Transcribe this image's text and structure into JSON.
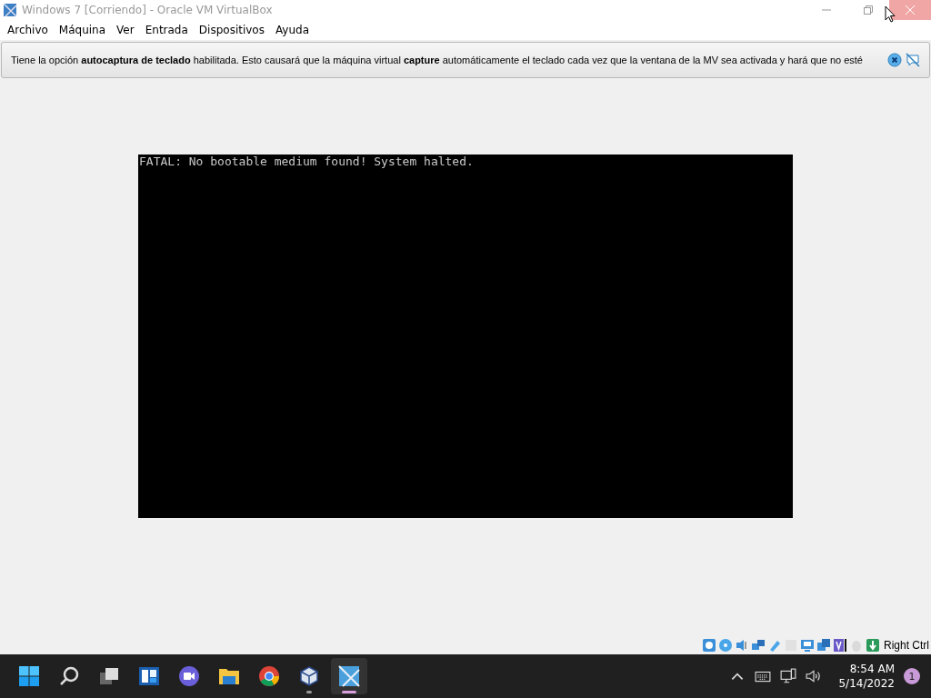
{
  "window": {
    "title": "Windows 7 [Corriendo] - Oracle VM VirtualBox",
    "active": false,
    "close_hovered": true
  },
  "menu": [
    "Archivo",
    "Máquina",
    "Ver",
    "Entrada",
    "Dispositivos",
    "Ayuda"
  ],
  "notice": {
    "message": "Tiene la opción **autocaptura de teclado** habilitada. Esto causará que la máquina virtual **capture** automáticamente el teclado cada vez que la ventana de la MV sea activada y hará que no esté"
  },
  "vm_screen": {
    "text": "FATAL: No bootable medium found! System halted."
  },
  "status_bar": {
    "icons": [
      {
        "kind": "disk",
        "disabled": false
      },
      {
        "kind": "optical",
        "disabled": false
      },
      {
        "kind": "audio",
        "disabled": false
      },
      {
        "kind": "network",
        "disabled": false
      },
      {
        "kind": "usb",
        "disabled": false
      },
      {
        "kind": "folder",
        "disabled": true
      },
      {
        "kind": "display",
        "disabled": false
      },
      {
        "kind": "recording",
        "disabled": false
      },
      {
        "kind": "vt",
        "disabled": false
      },
      {
        "kind": "mouse",
        "disabled": true
      },
      {
        "kind": "keyboard",
        "disabled": false
      }
    ],
    "host_key": "Right Ctrl"
  },
  "taskbar": {
    "apps": [
      {
        "kind": "start",
        "running": false,
        "selected": false
      },
      {
        "kind": "search",
        "running": false,
        "selected": false
      },
      {
        "kind": "taskview",
        "running": false,
        "selected": false
      },
      {
        "kind": "widgets",
        "running": false,
        "selected": false
      },
      {
        "kind": "chat",
        "running": false,
        "selected": false
      },
      {
        "kind": "explorer",
        "running": false,
        "selected": false
      },
      {
        "kind": "chrome",
        "running": false,
        "selected": false
      },
      {
        "kind": "virtualbox",
        "running": true,
        "selected": false
      },
      {
        "kind": "vm",
        "running": true,
        "selected": true
      }
    ],
    "time": "8:54 AM",
    "date": "5/14/2022",
    "notifications": "1"
  }
}
